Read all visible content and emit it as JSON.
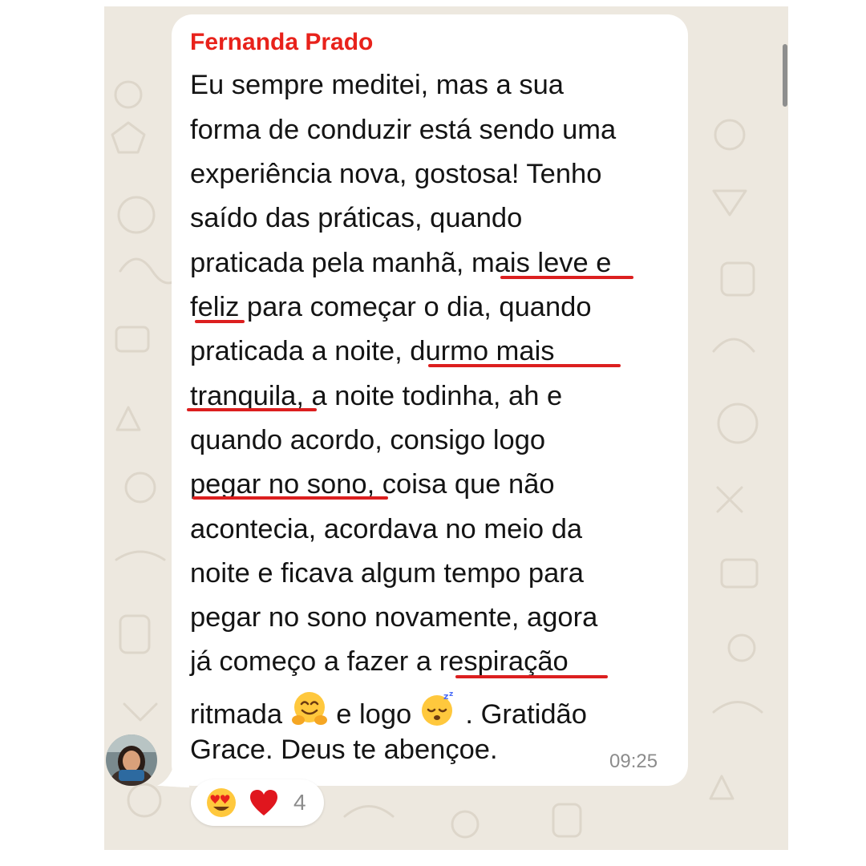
{
  "message": {
    "sender": "Fernanda Prado",
    "lines": [
      "Eu sempre meditei, mas a sua",
      "forma de conduzir está sendo uma",
      "experiência nova, gostosa! Tenho",
      "saído das práticas, quando",
      "praticada pela manhã, mais leve e",
      "feliz para começar o dia, quando",
      "praticada a noite, durmo mais",
      "tranquila, a noite todinha, ah e",
      "quando acordo, consigo logo",
      "pegar no sono, coisa que não",
      "acontecia, acordava no meio da",
      "noite e ficava algum tempo para",
      "pegar no sono novamente, agora",
      "já começo a fazer a respiração"
    ],
    "line15_part1": "ritmada",
    "line15_part2": "e logo",
    "line15_part3": ". Gratidão",
    "line16": "Grace. Deus te abençoe.",
    "time": "09:25"
  },
  "reactions": {
    "emojis": [
      "heart-eyes-emoji",
      "red-heart-emoji"
    ],
    "count": "4"
  },
  "colors": {
    "sender": "#e8221b",
    "underline": "#dc1f1f",
    "chat_background": "#ede8df"
  }
}
